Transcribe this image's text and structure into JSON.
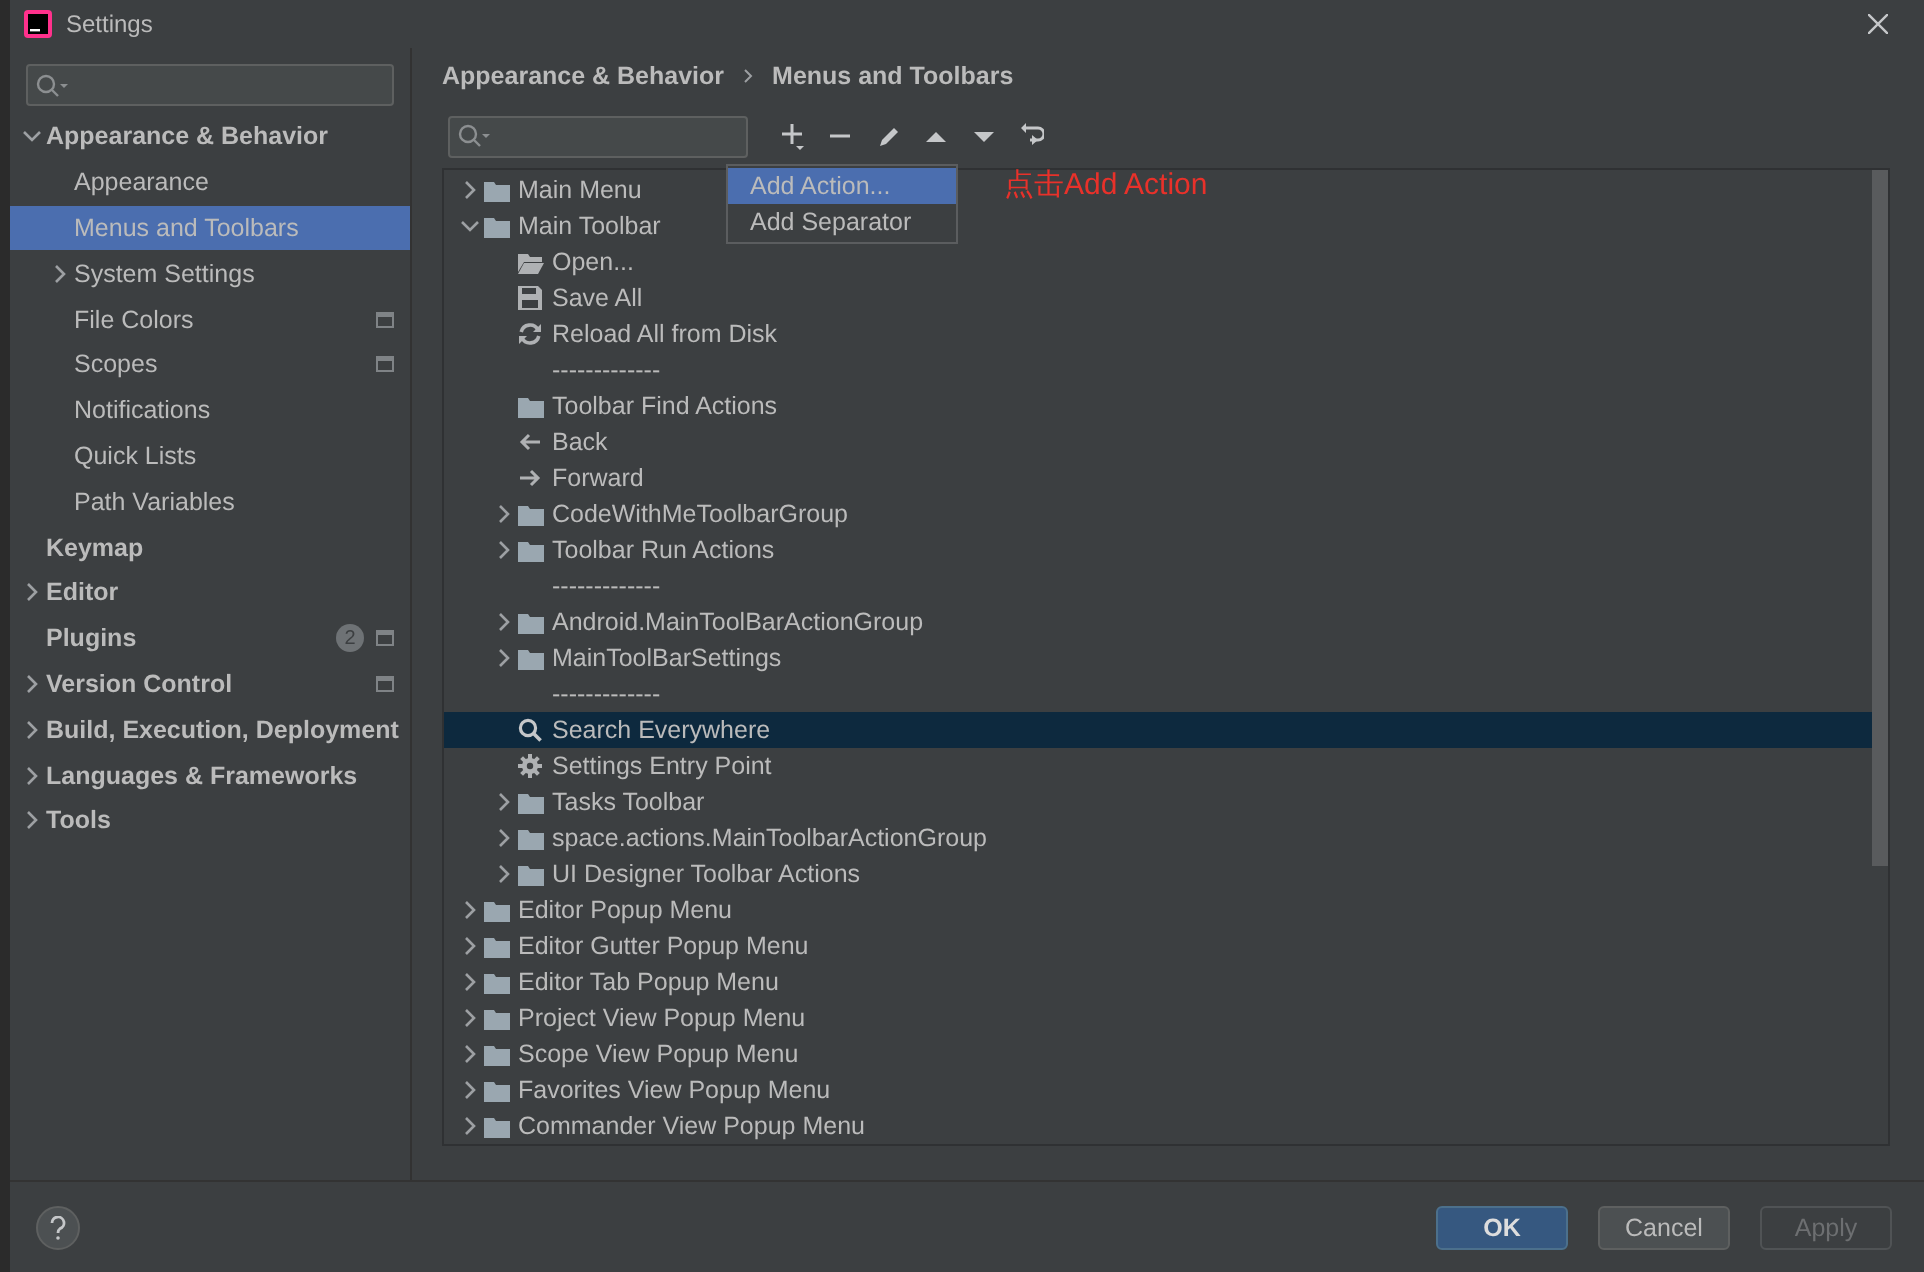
{
  "window": {
    "title": "Settings"
  },
  "sidebar": {
    "items": [
      {
        "label": "Appearance & Behavior",
        "bold": true,
        "expanded": true,
        "selected": false,
        "children": [
          {
            "label": "Appearance",
            "selected": false
          },
          {
            "label": "Menus and Toolbars",
            "selected": true
          },
          {
            "label": "System Settings",
            "expanded": false,
            "selected": false
          },
          {
            "label": "File Colors",
            "selected": false,
            "project_level": true
          },
          {
            "label": "Scopes",
            "selected": false,
            "project_level": true
          },
          {
            "label": "Notifications",
            "selected": false
          },
          {
            "label": "Quick Lists",
            "selected": false
          },
          {
            "label": "Path Variables",
            "selected": false
          }
        ]
      },
      {
        "label": "Keymap",
        "bold": true,
        "selected": false
      },
      {
        "label": "Editor",
        "bold": true,
        "expanded": false,
        "selected": false
      },
      {
        "label": "Plugins",
        "bold": true,
        "selected": false,
        "badge": "2",
        "project_level": true
      },
      {
        "label": "Version Control",
        "bold": true,
        "expanded": false,
        "selected": false,
        "project_level": true
      },
      {
        "label": "Build, Execution, Deployment",
        "bold": true,
        "expanded": false,
        "selected": false
      },
      {
        "label": "Languages & Frameworks",
        "bold": true,
        "expanded": false,
        "selected": false
      },
      {
        "label": "Tools",
        "bold": true,
        "expanded": false,
        "selected": false
      }
    ]
  },
  "breadcrumb": [
    "Appearance & Behavior",
    "Menus and Toolbars"
  ],
  "add_menu": {
    "items": [
      {
        "label": "Add Action...",
        "selected": true
      },
      {
        "label": "Add Separator",
        "selected": false
      }
    ]
  },
  "annotation": "点击Add Action",
  "tree": [
    {
      "kind": "folder",
      "label": "Main Menu",
      "expanded": false,
      "selected": false
    },
    {
      "kind": "folder",
      "label": "Main Toolbar",
      "expanded": true,
      "selected": false,
      "children": [
        {
          "kind": "open",
          "label": "Open...",
          "selected": false
        },
        {
          "kind": "save",
          "label": "Save All",
          "selected": false
        },
        {
          "kind": "reload",
          "label": "Reload All from Disk",
          "selected": false
        },
        {
          "kind": "separator",
          "label": "-------------",
          "selected": false
        },
        {
          "kind": "folder",
          "label": "Toolbar Find Actions",
          "selected": false
        },
        {
          "kind": "back",
          "label": "Back",
          "selected": false
        },
        {
          "kind": "forward",
          "label": "Forward",
          "selected": false
        },
        {
          "kind": "folder",
          "label": "CodeWithMeToolbarGroup",
          "expanded": false,
          "selected": false
        },
        {
          "kind": "folder",
          "label": "Toolbar Run Actions",
          "expanded": false,
          "selected": false
        },
        {
          "kind": "separator",
          "label": "-------------",
          "selected": false
        },
        {
          "kind": "folder",
          "label": "Android.MainToolBarActionGroup",
          "expanded": false,
          "selected": false
        },
        {
          "kind": "folder",
          "label": "MainToolBarSettings",
          "expanded": false,
          "selected": false
        },
        {
          "kind": "separator",
          "label": "-------------",
          "selected": false
        },
        {
          "kind": "search",
          "label": "Search Everywhere",
          "selected": true
        },
        {
          "kind": "gear",
          "label": "Settings Entry Point",
          "selected": false
        },
        {
          "kind": "folder",
          "label": "Tasks Toolbar",
          "expanded": false,
          "selected": false
        },
        {
          "kind": "folder",
          "label": "space.actions.MainToolbarActionGroup",
          "expanded": false,
          "selected": false
        },
        {
          "kind": "folder",
          "label": "UI Designer Toolbar Actions",
          "expanded": false,
          "selected": false
        }
      ]
    },
    {
      "kind": "folder",
      "label": "Editor Popup Menu",
      "expanded": false,
      "selected": false
    },
    {
      "kind": "folder",
      "label": "Editor Gutter Popup Menu",
      "expanded": false,
      "selected": false
    },
    {
      "kind": "folder",
      "label": "Editor Tab Popup Menu",
      "expanded": false,
      "selected": false
    },
    {
      "kind": "folder",
      "label": "Project View Popup Menu",
      "expanded": false,
      "selected": false
    },
    {
      "kind": "folder",
      "label": "Scope View Popup Menu",
      "expanded": false,
      "selected": false
    },
    {
      "kind": "folder",
      "label": "Favorites View Popup Menu",
      "expanded": false,
      "selected": false
    },
    {
      "kind": "folder",
      "label": "Commander View Popup Menu",
      "expanded": false,
      "selected": false
    }
  ],
  "buttons": [
    {
      "label": "OK",
      "default": true,
      "disabled": false
    },
    {
      "label": "Cancel",
      "default": false,
      "disabled": false
    },
    {
      "label": "Apply",
      "default": false,
      "disabled": true
    }
  ]
}
